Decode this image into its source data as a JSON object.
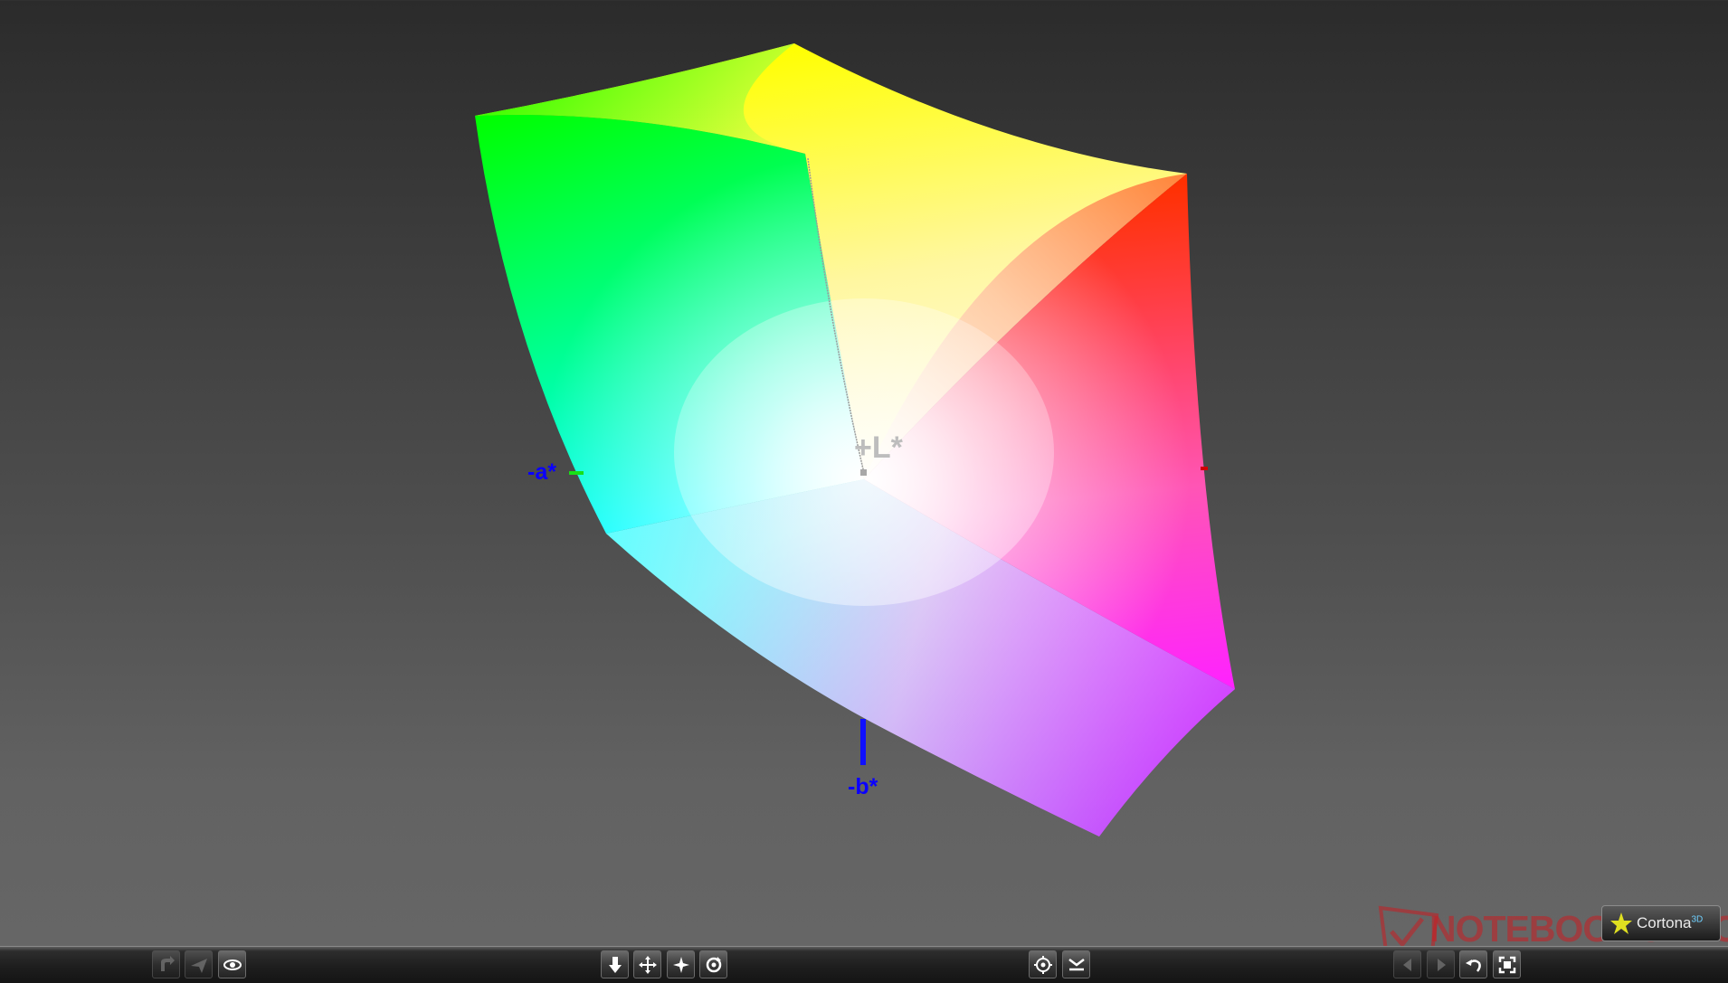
{
  "viewer": {
    "axis_labels": {
      "minus_a": "-a*",
      "minus_b": "-b*",
      "plus_L": "+L*"
    },
    "gamut_colors": {
      "green": "#00ff00",
      "yellow": "#ffff00",
      "red": "#ff2a00",
      "cyan": "#00ffff",
      "blue": "#9955ff",
      "magenta": "#ff22ff",
      "white": "#ffffff"
    },
    "background": {
      "top": "#2b2b2b",
      "bottom": "#676767"
    }
  },
  "toolbar": {
    "left_group": [
      {
        "name": "turn-icon",
        "enabled": false
      },
      {
        "name": "fly-icon",
        "enabled": false
      },
      {
        "name": "eye-icon",
        "enabled": true
      }
    ],
    "center_group": [
      {
        "name": "walk-icon",
        "enabled": true
      },
      {
        "name": "pan-icon",
        "enabled": true
      },
      {
        "name": "fly-mode-icon",
        "enabled": true
      },
      {
        "name": "rotate-icon",
        "enabled": true
      }
    ],
    "right_group": [
      {
        "name": "target-icon",
        "enabled": true
      },
      {
        "name": "align-icon",
        "enabled": true
      }
    ],
    "far_right_group": [
      {
        "name": "previous-viewpoint-icon",
        "enabled": false
      },
      {
        "name": "next-viewpoint-icon",
        "enabled": false
      },
      {
        "name": "undo-icon",
        "enabled": true
      },
      {
        "name": "fit-icon",
        "enabled": true
      }
    ]
  },
  "watermark": {
    "text": "NOTEBOOKCHECK"
  },
  "badge": {
    "text": "Cortona",
    "superscript": "3D"
  }
}
